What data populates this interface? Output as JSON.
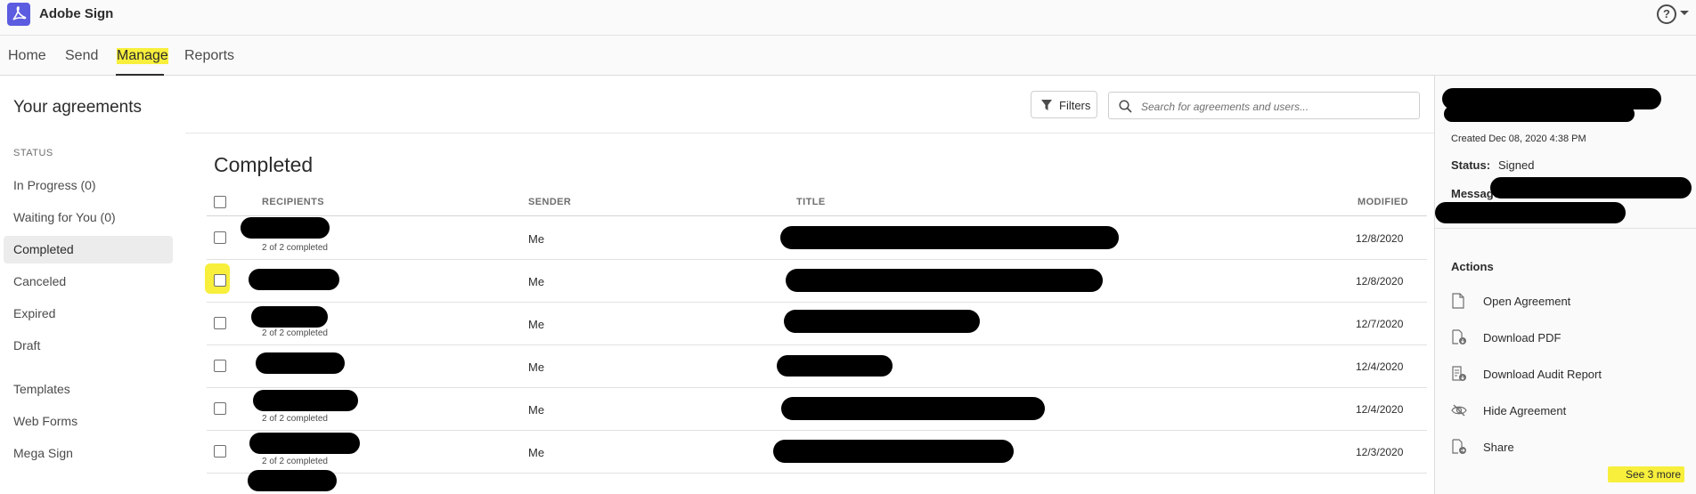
{
  "app": {
    "title": "Adobe Sign"
  },
  "nav": {
    "tabs": [
      {
        "label": "Home"
      },
      {
        "label": "Send"
      },
      {
        "label": "Manage"
      },
      {
        "label": "Reports"
      }
    ]
  },
  "sidebar": {
    "page_title": "Your agreements",
    "status_header": "STATUS",
    "status_items": [
      {
        "label": "In Progress (0)"
      },
      {
        "label": "Waiting for You (0)"
      },
      {
        "label": "Completed"
      },
      {
        "label": "Canceled"
      },
      {
        "label": "Expired"
      },
      {
        "label": "Draft"
      }
    ],
    "other_items": [
      {
        "label": "Templates"
      },
      {
        "label": "Web Forms"
      },
      {
        "label": "Mega Sign"
      }
    ]
  },
  "toolbar": {
    "filters_label": "Filters",
    "search_placeholder": "Search for agreements and users..."
  },
  "main": {
    "section_title": "Completed",
    "columns": {
      "recipients": "RECIPIENTS",
      "sender": "SENDER",
      "title": "TITLE",
      "modified": "MODIFIED"
    },
    "rows": [
      {
        "sub": "2 of 2 completed",
        "sender": "Me",
        "modified": "12/8/2020"
      },
      {
        "sub": "",
        "sender": "Me",
        "modified": "12/8/2020"
      },
      {
        "sub": "2 of 2 completed",
        "sender": "Me",
        "modified": "12/7/2020"
      },
      {
        "sub": "",
        "sender": "Me",
        "modified": "12/4/2020"
      },
      {
        "sub": "2 of 2 completed",
        "sender": "Me",
        "modified": "12/4/2020"
      },
      {
        "sub": "2 of 2 completed",
        "sender": "Me",
        "modified": "12/3/2020"
      }
    ]
  },
  "details": {
    "created": "Created Dec 08, 2020 4:38 PM",
    "status_label": "Status:",
    "status_value": "Signed",
    "message_label": "Message",
    "actions_header": "Actions",
    "actions": [
      {
        "label": "Open Agreement",
        "icon": "document-icon"
      },
      {
        "label": "Download PDF",
        "icon": "download-pdf-icon"
      },
      {
        "label": "Download Audit Report",
        "icon": "audit-report-icon"
      },
      {
        "label": "Hide Agreement",
        "icon": "hide-eye-icon"
      },
      {
        "label": "Share",
        "icon": "share-icon"
      }
    ],
    "see_more": "See 3 more"
  },
  "colors": {
    "brand": "#5c5ce0",
    "highlight": "#f7ef3b",
    "redaction": "#000000"
  }
}
